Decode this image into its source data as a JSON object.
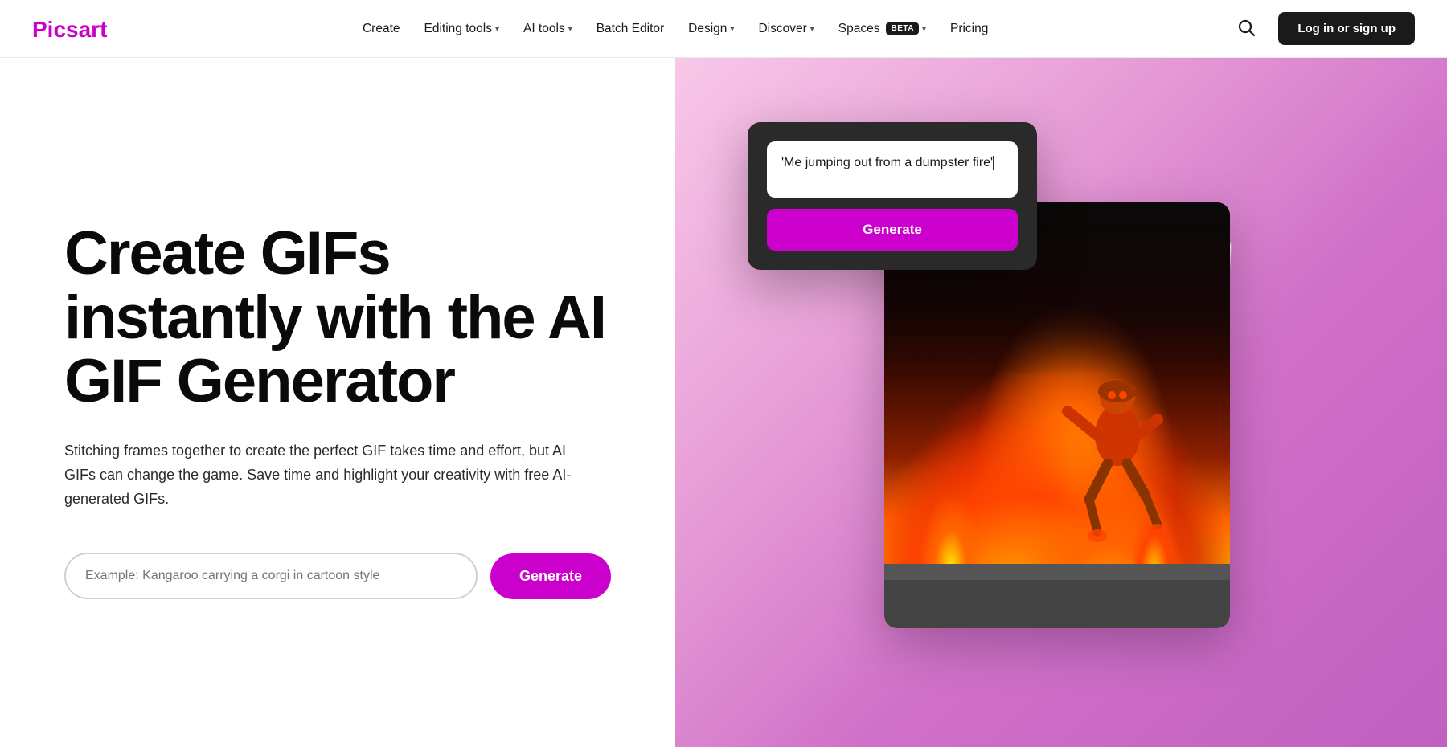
{
  "navbar": {
    "logo_text": "Picsart",
    "links": [
      {
        "id": "create",
        "label": "Create",
        "has_dropdown": false
      },
      {
        "id": "editing-tools",
        "label": "Editing tools",
        "has_dropdown": true
      },
      {
        "id": "ai-tools",
        "label": "AI tools",
        "has_dropdown": true
      },
      {
        "id": "batch-editor",
        "label": "Batch Editor",
        "has_dropdown": false
      },
      {
        "id": "design",
        "label": "Design",
        "has_dropdown": true
      },
      {
        "id": "discover",
        "label": "Discover",
        "has_dropdown": true
      },
      {
        "id": "spaces",
        "label": "Spaces",
        "has_dropdown": true,
        "badge": "BETA"
      },
      {
        "id": "pricing",
        "label": "Pricing",
        "has_dropdown": false
      }
    ],
    "login_label": "Log in or sign up"
  },
  "hero": {
    "title": "Create GIFs instantly with the AI GIF Generator",
    "description": "Stitching frames together to create the perfect GIF takes time and effort, but AI GIFs can change the game. Save time and highlight your creativity with free AI-generated GIFs.",
    "input_placeholder": "Example: Kangaroo carrying a corgi in cartoon style",
    "generate_label": "Generate"
  },
  "prompt_card": {
    "prompt_text": "'Me jumping out from a dumpster fire'",
    "generate_label": "Generate"
  },
  "icons": {
    "search": "🔍",
    "chevron": "▾"
  }
}
